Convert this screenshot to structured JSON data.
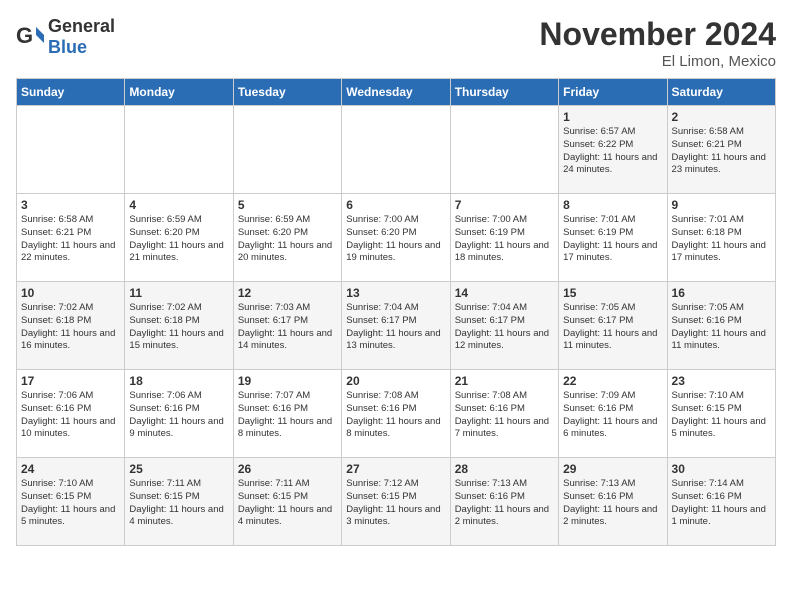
{
  "logo": {
    "text_general": "General",
    "text_blue": "Blue"
  },
  "header": {
    "month": "November 2024",
    "location": "El Limon, Mexico"
  },
  "weekdays": [
    "Sunday",
    "Monday",
    "Tuesday",
    "Wednesday",
    "Thursday",
    "Friday",
    "Saturday"
  ],
  "weeks": [
    [
      {
        "day": "",
        "info": ""
      },
      {
        "day": "",
        "info": ""
      },
      {
        "day": "",
        "info": ""
      },
      {
        "day": "",
        "info": ""
      },
      {
        "day": "",
        "info": ""
      },
      {
        "day": "1",
        "info": "Sunrise: 6:57 AM\nSunset: 6:22 PM\nDaylight: 11 hours and 24 minutes."
      },
      {
        "day": "2",
        "info": "Sunrise: 6:58 AM\nSunset: 6:21 PM\nDaylight: 11 hours and 23 minutes."
      }
    ],
    [
      {
        "day": "3",
        "info": "Sunrise: 6:58 AM\nSunset: 6:21 PM\nDaylight: 11 hours and 22 minutes."
      },
      {
        "day": "4",
        "info": "Sunrise: 6:59 AM\nSunset: 6:20 PM\nDaylight: 11 hours and 21 minutes."
      },
      {
        "day": "5",
        "info": "Sunrise: 6:59 AM\nSunset: 6:20 PM\nDaylight: 11 hours and 20 minutes."
      },
      {
        "day": "6",
        "info": "Sunrise: 7:00 AM\nSunset: 6:20 PM\nDaylight: 11 hours and 19 minutes."
      },
      {
        "day": "7",
        "info": "Sunrise: 7:00 AM\nSunset: 6:19 PM\nDaylight: 11 hours and 18 minutes."
      },
      {
        "day": "8",
        "info": "Sunrise: 7:01 AM\nSunset: 6:19 PM\nDaylight: 11 hours and 17 minutes."
      },
      {
        "day": "9",
        "info": "Sunrise: 7:01 AM\nSunset: 6:18 PM\nDaylight: 11 hours and 17 minutes."
      }
    ],
    [
      {
        "day": "10",
        "info": "Sunrise: 7:02 AM\nSunset: 6:18 PM\nDaylight: 11 hours and 16 minutes."
      },
      {
        "day": "11",
        "info": "Sunrise: 7:02 AM\nSunset: 6:18 PM\nDaylight: 11 hours and 15 minutes."
      },
      {
        "day": "12",
        "info": "Sunrise: 7:03 AM\nSunset: 6:17 PM\nDaylight: 11 hours and 14 minutes."
      },
      {
        "day": "13",
        "info": "Sunrise: 7:04 AM\nSunset: 6:17 PM\nDaylight: 11 hours and 13 minutes."
      },
      {
        "day": "14",
        "info": "Sunrise: 7:04 AM\nSunset: 6:17 PM\nDaylight: 11 hours and 12 minutes."
      },
      {
        "day": "15",
        "info": "Sunrise: 7:05 AM\nSunset: 6:17 PM\nDaylight: 11 hours and 11 minutes."
      },
      {
        "day": "16",
        "info": "Sunrise: 7:05 AM\nSunset: 6:16 PM\nDaylight: 11 hours and 11 minutes."
      }
    ],
    [
      {
        "day": "17",
        "info": "Sunrise: 7:06 AM\nSunset: 6:16 PM\nDaylight: 11 hours and 10 minutes."
      },
      {
        "day": "18",
        "info": "Sunrise: 7:06 AM\nSunset: 6:16 PM\nDaylight: 11 hours and 9 minutes."
      },
      {
        "day": "19",
        "info": "Sunrise: 7:07 AM\nSunset: 6:16 PM\nDaylight: 11 hours and 8 minutes."
      },
      {
        "day": "20",
        "info": "Sunrise: 7:08 AM\nSunset: 6:16 PM\nDaylight: 11 hours and 8 minutes."
      },
      {
        "day": "21",
        "info": "Sunrise: 7:08 AM\nSunset: 6:16 PM\nDaylight: 11 hours and 7 minutes."
      },
      {
        "day": "22",
        "info": "Sunrise: 7:09 AM\nSunset: 6:16 PM\nDaylight: 11 hours and 6 minutes."
      },
      {
        "day": "23",
        "info": "Sunrise: 7:10 AM\nSunset: 6:15 PM\nDaylight: 11 hours and 5 minutes."
      }
    ],
    [
      {
        "day": "24",
        "info": "Sunrise: 7:10 AM\nSunset: 6:15 PM\nDaylight: 11 hours and 5 minutes."
      },
      {
        "day": "25",
        "info": "Sunrise: 7:11 AM\nSunset: 6:15 PM\nDaylight: 11 hours and 4 minutes."
      },
      {
        "day": "26",
        "info": "Sunrise: 7:11 AM\nSunset: 6:15 PM\nDaylight: 11 hours and 4 minutes."
      },
      {
        "day": "27",
        "info": "Sunrise: 7:12 AM\nSunset: 6:15 PM\nDaylight: 11 hours and 3 minutes."
      },
      {
        "day": "28",
        "info": "Sunrise: 7:13 AM\nSunset: 6:16 PM\nDaylight: 11 hours and 2 minutes."
      },
      {
        "day": "29",
        "info": "Sunrise: 7:13 AM\nSunset: 6:16 PM\nDaylight: 11 hours and 2 minutes."
      },
      {
        "day": "30",
        "info": "Sunrise: 7:14 AM\nSunset: 6:16 PM\nDaylight: 11 hours and 1 minute."
      }
    ]
  ]
}
